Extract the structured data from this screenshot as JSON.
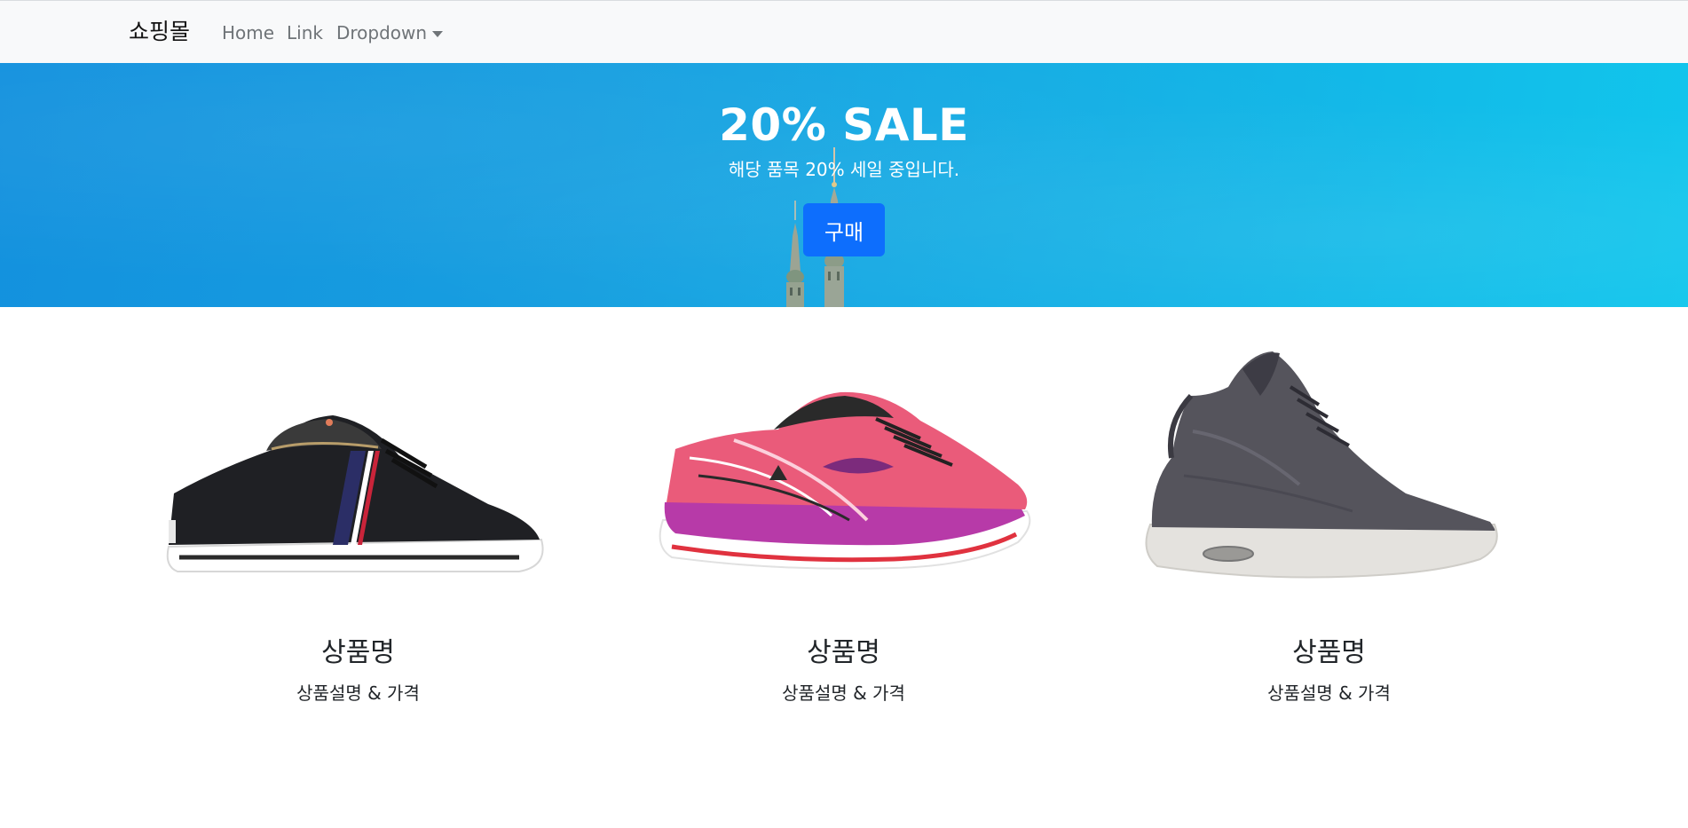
{
  "navbar": {
    "brand": "쇼핑몰",
    "links": [
      "Home",
      "Link",
      "Dropdown"
    ]
  },
  "hero": {
    "title": "20% SALE",
    "subtitle": "해당 품목 20% 세일 중입니다.",
    "button_label": "구매"
  },
  "products": [
    {
      "name": "상품명",
      "description": "상품설명 & 가격",
      "image_icon": "black-sneaker-image"
    },
    {
      "name": "상품명",
      "description": "상품설명 & 가격",
      "image_icon": "pink-running-shoe-image"
    },
    {
      "name": "상품명",
      "description": "상품설명 & 가격",
      "image_icon": "gray-high-top-sneaker-image"
    }
  ],
  "colors": {
    "navbar_bg": "#f8f9fa",
    "hero_bg": "#179fe0",
    "button_primary": "#0d6efd"
  }
}
